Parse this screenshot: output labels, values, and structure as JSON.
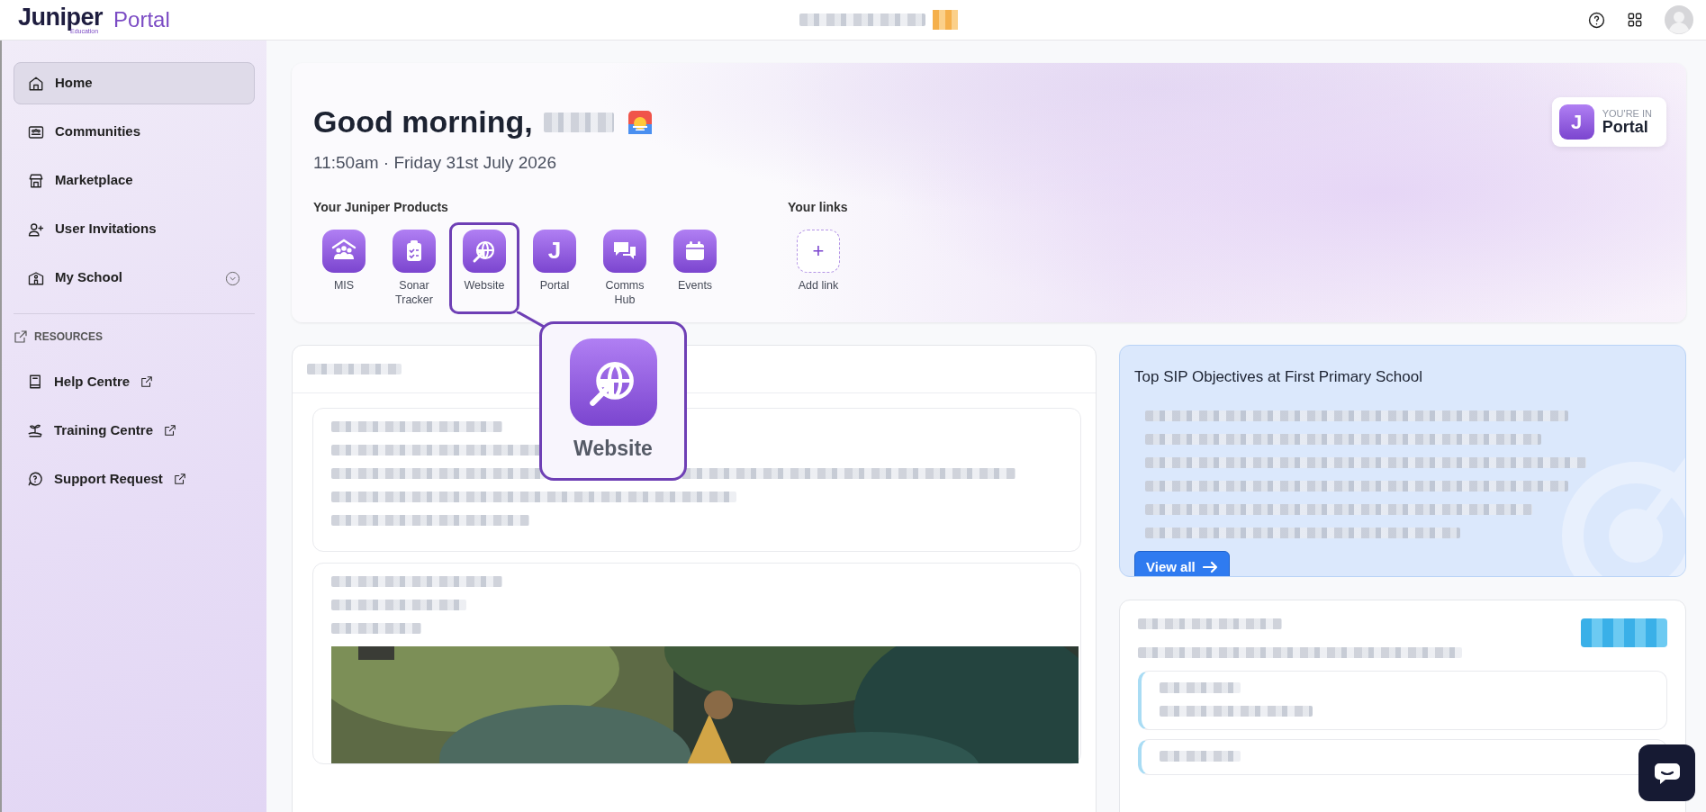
{
  "header": {
    "logo": "Juniper",
    "logo_sub": "Education",
    "product": "Portal"
  },
  "sidebar": {
    "items": [
      {
        "label": "Home",
        "selected": true,
        "expandable": false
      },
      {
        "label": "Communities",
        "selected": false,
        "expandable": false
      },
      {
        "label": "Marketplace",
        "selected": false,
        "expandable": false
      },
      {
        "label": "User Invitations",
        "selected": false,
        "expandable": false
      },
      {
        "label": "My School",
        "selected": false,
        "expandable": true
      }
    ],
    "section": "RESOURCES",
    "resources": [
      {
        "label": "Help Centre"
      },
      {
        "label": "Training Centre"
      },
      {
        "label": "Support Request"
      }
    ]
  },
  "hero": {
    "greeting": "Good morning,",
    "time": "11:50am · Friday 31st July 2026",
    "products_title": "Your Juniper Products",
    "products": [
      {
        "label": "MIS",
        "highlighted": false
      },
      {
        "label": "Sonar Tracker",
        "highlighted": false
      },
      {
        "label": "Website",
        "highlighted": true
      },
      {
        "label": "Portal",
        "glyph": "J",
        "highlighted": false
      },
      {
        "label": "Comms Hub",
        "highlighted": false
      },
      {
        "label": "Events",
        "highlighted": false
      }
    ],
    "links_title": "Your links",
    "add_link": {
      "symbol": "+",
      "label": "Add link"
    },
    "badge": {
      "caption": "YOU'RE IN",
      "product": "Portal",
      "letter": "J"
    }
  },
  "callout": {
    "label": "Website"
  },
  "sip": {
    "title": "Top SIP Objectives at First Primary School",
    "button": "View all"
  }
}
